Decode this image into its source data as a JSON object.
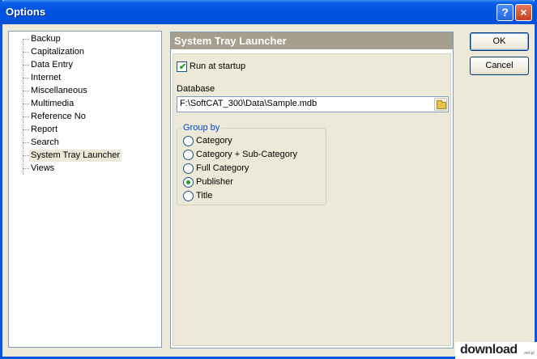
{
  "window": {
    "title": "Options",
    "help_label": "?",
    "close_label": "×"
  },
  "tree": {
    "items": [
      {
        "label": "Backup"
      },
      {
        "label": "Capitalization"
      },
      {
        "label": "Data Entry"
      },
      {
        "label": "Internet"
      },
      {
        "label": "Miscellaneous"
      },
      {
        "label": "Multimedia"
      },
      {
        "label": "Reference No"
      },
      {
        "label": "Report"
      },
      {
        "label": "Search"
      },
      {
        "label": "System Tray Launcher",
        "selected": true
      },
      {
        "label": "Views"
      }
    ]
  },
  "panel": {
    "header": "System Tray Launcher",
    "run_at_startup": {
      "label": "Run at startup",
      "checked": true
    },
    "database": {
      "label": "Database",
      "value": "F:\\SoftCAT_300\\Data\\Sample.mdb"
    },
    "group_by": {
      "title": "Group by",
      "options": [
        {
          "label": "Category"
        },
        {
          "label": "Category + Sub-Category"
        },
        {
          "label": "Full Category"
        },
        {
          "label": "Publisher",
          "selected": true
        },
        {
          "label": "Title"
        }
      ]
    }
  },
  "buttons": {
    "ok": "OK",
    "cancel": "Cancel"
  },
  "watermark": {
    "text": "download",
    "suffix": ".net.pl"
  },
  "colors": {
    "title_bar": "#0053e1",
    "panel_header": "#a69f8e",
    "check_mark": "#21a121",
    "group_title": "#0046d5"
  }
}
